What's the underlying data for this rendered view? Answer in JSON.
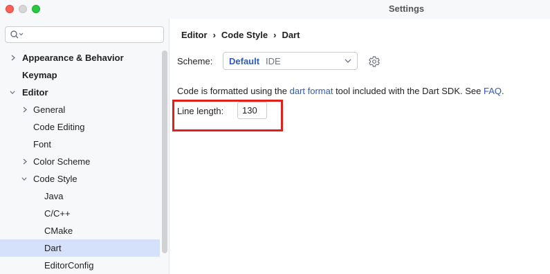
{
  "window": {
    "title": "Settings"
  },
  "search": {
    "placeholder": "",
    "value": ""
  },
  "sidebar": {
    "items": [
      {
        "label": "Appearance & Behavior"
      },
      {
        "label": "Keymap"
      },
      {
        "label": "Editor"
      },
      {
        "label": "General"
      },
      {
        "label": "Code Editing"
      },
      {
        "label": "Font"
      },
      {
        "label": "Color Scheme"
      },
      {
        "label": "Code Style"
      },
      {
        "label": "Java"
      },
      {
        "label": "C/C++"
      },
      {
        "label": "CMake"
      },
      {
        "label": "Dart"
      },
      {
        "label": "EditorConfig"
      }
    ]
  },
  "breadcrumb": [
    "Editor",
    "Code Style",
    "Dart"
  ],
  "breadcrumb_separator": "›",
  "scheme": {
    "label": "Scheme:",
    "name": "Default",
    "type": "IDE"
  },
  "info": {
    "before": "Code is formatted using the ",
    "link1": "dart format",
    "middle": " tool included with the Dart SDK. See ",
    "link2": "FAQ",
    "after": "."
  },
  "line_length": {
    "label": "Line length:",
    "value": "130"
  },
  "colors": {
    "accent": "#2c5bb8",
    "selection": "#d5e1fb",
    "highlight_border": "#e0211b"
  }
}
